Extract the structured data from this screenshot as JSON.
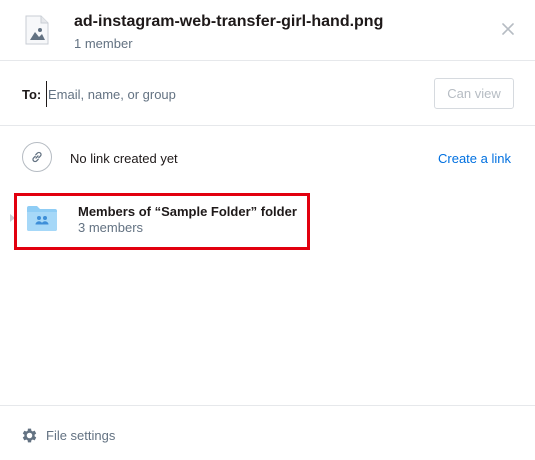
{
  "header": {
    "file_name": "ad-instagram-web-transfer-girl-hand.png",
    "member_count": "1 member",
    "file_icon": "image-file-icon",
    "close_icon": "close-icon"
  },
  "share": {
    "to_label": "To:",
    "input_placeholder": "Email, name, or group",
    "input_value": "",
    "permission_label": "Can view"
  },
  "link": {
    "icon": "link-icon",
    "status_text": "No link created yet",
    "create_label": "Create a link",
    "create_color": "#0070e0"
  },
  "members": [
    {
      "icon": "shared-folder-icon",
      "title": "Members of “Sample Folder” folder",
      "count": "3 members",
      "highlighted": true,
      "highlight_color": "#e2000f"
    }
  ],
  "footer": {
    "icon": "gear-icon",
    "settings_label": "File settings"
  },
  "colors": {
    "folder_blue": "#8fcdf5",
    "folder_dark_blue": "#5a9dd5",
    "link_blue": "#0070e0",
    "muted_text": "#637282",
    "border": "#e6e8eb"
  }
}
